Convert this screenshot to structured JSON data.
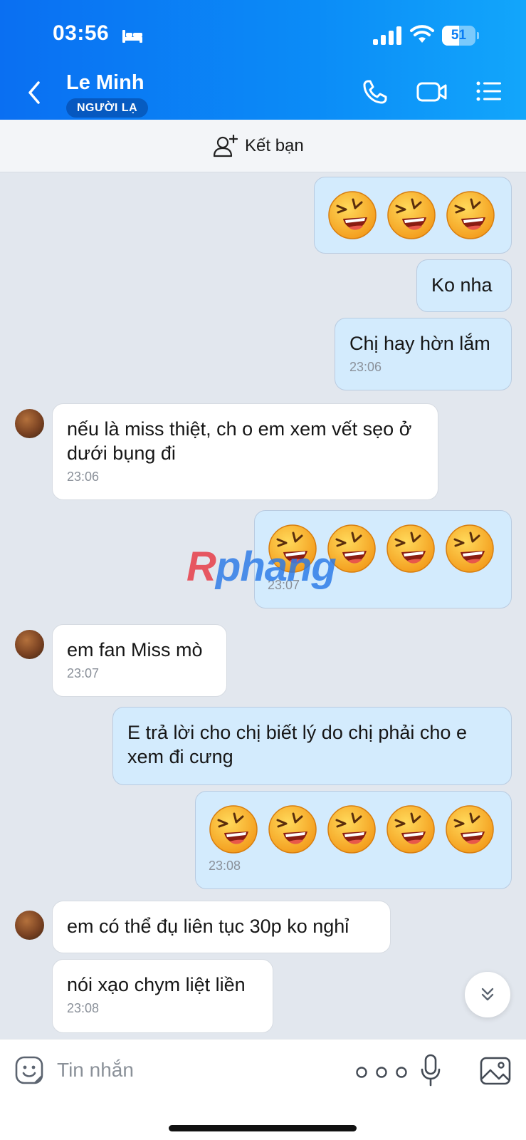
{
  "status_bar": {
    "time": "03:56",
    "battery": "51",
    "battery_level": 0.51
  },
  "header": {
    "contact_name": "Le Minh",
    "badge": "NGƯỜI LẠ",
    "icons": [
      "back-icon",
      "call-icon",
      "video-call-icon",
      "menu-icon"
    ]
  },
  "add_friend": {
    "label": "Kết bạn"
  },
  "messages": [
    {
      "direction": "sent",
      "emoji_count": 3
    },
    {
      "direction": "sent",
      "text": "Ko nha"
    },
    {
      "direction": "sent",
      "text": "Chị hay hờn lắm",
      "time": "23:06"
    },
    {
      "direction": "received",
      "text": "nếu là miss thiệt, ch o em xem vết sẹo ở dưới bụng đi",
      "time": "23:06"
    },
    {
      "direction": "sent",
      "emoji_count": 4,
      "time": "23:07"
    },
    {
      "direction": "received",
      "text": "em fan Miss mò",
      "time": "23:07"
    },
    {
      "direction": "sent",
      "text": "E trả lời cho chị biết lý do chị phải cho e xem đi cưng"
    },
    {
      "direction": "sent",
      "emoji_count": 5,
      "time": "23:08"
    },
    {
      "direction": "received",
      "text": "em có thể đụ liên tục 30p ko nghỉ"
    },
    {
      "direction": "received",
      "text": "nói xạo chym liệt liền",
      "time": "23:08"
    }
  ],
  "watermark": {
    "text": "Rphang"
  },
  "input": {
    "placeholder": "Tin nhắn"
  },
  "colors": {
    "header_start": "#0a6ff2",
    "header_end": "#12a6fb",
    "sent_bubble": "#d3ebfd",
    "chat_bg": "#e2e7ee"
  }
}
